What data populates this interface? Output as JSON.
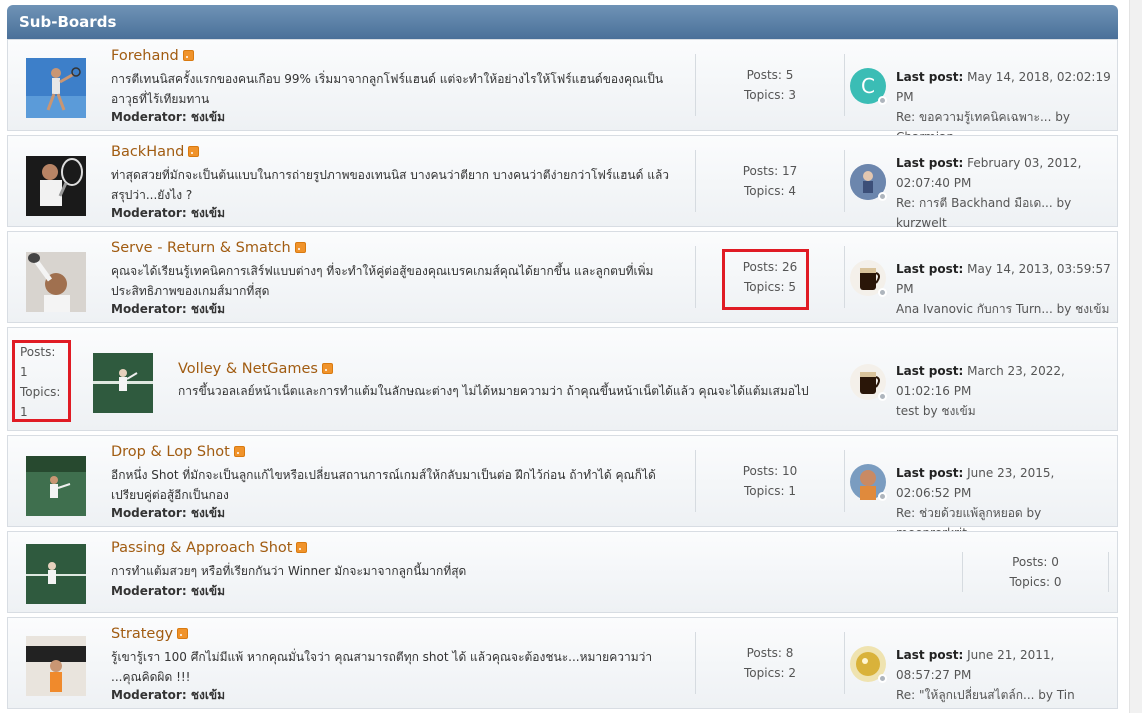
{
  "header": {
    "title": "Sub-Boards"
  },
  "moderator_label": "Moderator:",
  "posts_label": "Posts:",
  "topics_label": "Topics:",
  "lastpost_label": "Last post:",
  "boards": [
    {
      "title": "Forehand",
      "desc": "การตีเทนนิสครั้งแรกของคนเกือบ 99% เริ่มมาจากลูกโฟร์แฮนด์ แต่จะทำให้อย่างไรให้โฟร์แฮนด์ของคุณเป็นอาวุธที่ไร้เทียมทาน",
      "moderator": "ชงเข้ม",
      "posts": "5",
      "topics": "3",
      "last_time": "May 14, 2018, 02:02:19 PM",
      "last_topic": "Re: ขอความรู้เทคนิคเฉพาะ... by Charmian",
      "avatar": "C"
    },
    {
      "title": "BackHand",
      "desc": "ท่าสุดสวยที่มักจะเป็นต้นแบบในการถ่ายรูปภาพของเทนนิส บางคนว่าตียาก บางคนว่าตีง่ายกว่าโฟร์แฮนด์ แล้วสรุปว่า...ยังไง ?",
      "moderator": "ชงเข้ม",
      "posts": "17",
      "topics": "4",
      "last_time": "February 03, 2012, 02:07:40 PM",
      "last_topic": "Re: การตี Backhand มือเด... by kurzwelt"
    },
    {
      "title": "Serve - Return & Smatch",
      "desc": "คุณจะได้เรียนรู้เทคนิคการเสิร์ฟแบบต่างๆ ที่จะทำให้คู่ต่อสู้ของคุณเบรคเกมส์คุณได้ยากขึ้น และลูกตบที่เพิ่มประสิทธิภาพของเกมส์มากที่สุด",
      "moderator": "ชงเข้ม",
      "posts": "26",
      "topics": "5",
      "last_time": "May 14, 2013, 03:59:57 PM",
      "last_topic": "Ana Ivanovic กับการ Turn... by ชงเข้ม"
    },
    {
      "title": "Volley & NetGames",
      "desc": "การขึ้นวอลเลย์หน้าเน็ตและการทำแต้มในลักษณะต่างๆ ไม่ได้หมายความว่า ถ้าคุณขึ้นหน้าเน็ตได้แล้ว คุณจะได้แต้มเสมอไป",
      "posts": "1",
      "topics": "1",
      "last_time": "March 23, 2022, 01:02:16 PM",
      "last_topic": "test by ชงเข้ม"
    },
    {
      "title": "Drop & Lop Shot",
      "desc": "อีกหนึ่ง Shot ที่มักจะเป็นลูกแก้ไขหรือเปลี่ยนสถานการณ์เกมส์ให้กลับมาเป็นต่อ ฝึกไว้ก่อน ถ้าทำได้ คุณก็ได้เปรียบคู่ต่อสู้อีกเป็นกอง",
      "moderator": "ชงเข้ม",
      "posts": "10",
      "topics": "1",
      "last_time": "June 23, 2015, 02:06:52 PM",
      "last_topic": "Re: ช่วยด้วยแพ้ลูกหยอด by meenrerkrit"
    },
    {
      "title": "Passing & Approach Shot",
      "desc": "การทำแต้มสวยๆ หรือที่เรียกกันว่า Winner มักจะมาจากลูกนี้มากที่สุด",
      "moderator": "ชงเข้ม",
      "posts": "0",
      "topics": "0"
    },
    {
      "title": "Strategy",
      "desc": "รู้เขารู้เรา 100 ศึกไม่มีแพ้ หากคุณมั่นใจว่า คุณสามารถตีทุก shot ได้ แล้วคุณจะต้องชนะ...หมายความว่า ...คุณคิดผิด !!!",
      "moderator": "ชงเข้ม",
      "posts": "8",
      "topics": "2",
      "last_time": "June 21, 2011, 08:57:27 PM",
      "last_topic": "Re: \"ให้ลูกเปลี่ยนสไตล์ก... by Tin"
    }
  ],
  "colors": {
    "header": "#5b7fa6",
    "title_link": "#a15c12",
    "highlight": "#e01b24"
  }
}
